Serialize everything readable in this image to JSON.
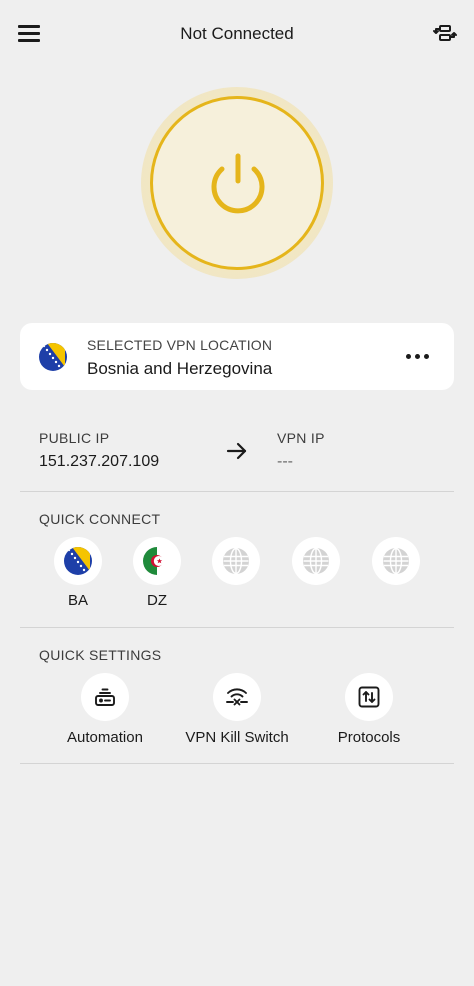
{
  "header": {
    "title": "Not Connected",
    "menu_icon": "hamburger-menu-icon",
    "switch_icon": "server-switch-icon"
  },
  "power": {
    "icon": "power-icon",
    "accent_color": "#e5b51b"
  },
  "location": {
    "label": "SELECTED VPN LOCATION",
    "name": "Bosnia and Herzegovina",
    "flag_icon": "bosnia-flag-icon",
    "more_icon": "more-horizontal-icon"
  },
  "ip": {
    "public_label": "PUBLIC IP",
    "public_value": "151.237.207.109",
    "vpn_label": "VPN IP",
    "vpn_value": "---",
    "arrow_icon": "arrow-right-icon"
  },
  "quick_connect": {
    "title": "QUICK CONNECT",
    "items": [
      {
        "code": "BA",
        "icon": "bosnia-flag-icon"
      },
      {
        "code": "DZ",
        "icon": "algeria-flag-icon"
      },
      {
        "code": "",
        "icon": "globe-icon"
      },
      {
        "code": "",
        "icon": "globe-icon"
      },
      {
        "code": "",
        "icon": "globe-icon"
      }
    ]
  },
  "quick_settings": {
    "title": "QUICK SETTINGS",
    "items": [
      {
        "label": "Automation",
        "icon": "automation-router-icon"
      },
      {
        "label": "VPN Kill Switch",
        "icon": "kill-switch-wifi-icon"
      },
      {
        "label": "Protocols",
        "icon": "protocols-icon"
      }
    ]
  }
}
